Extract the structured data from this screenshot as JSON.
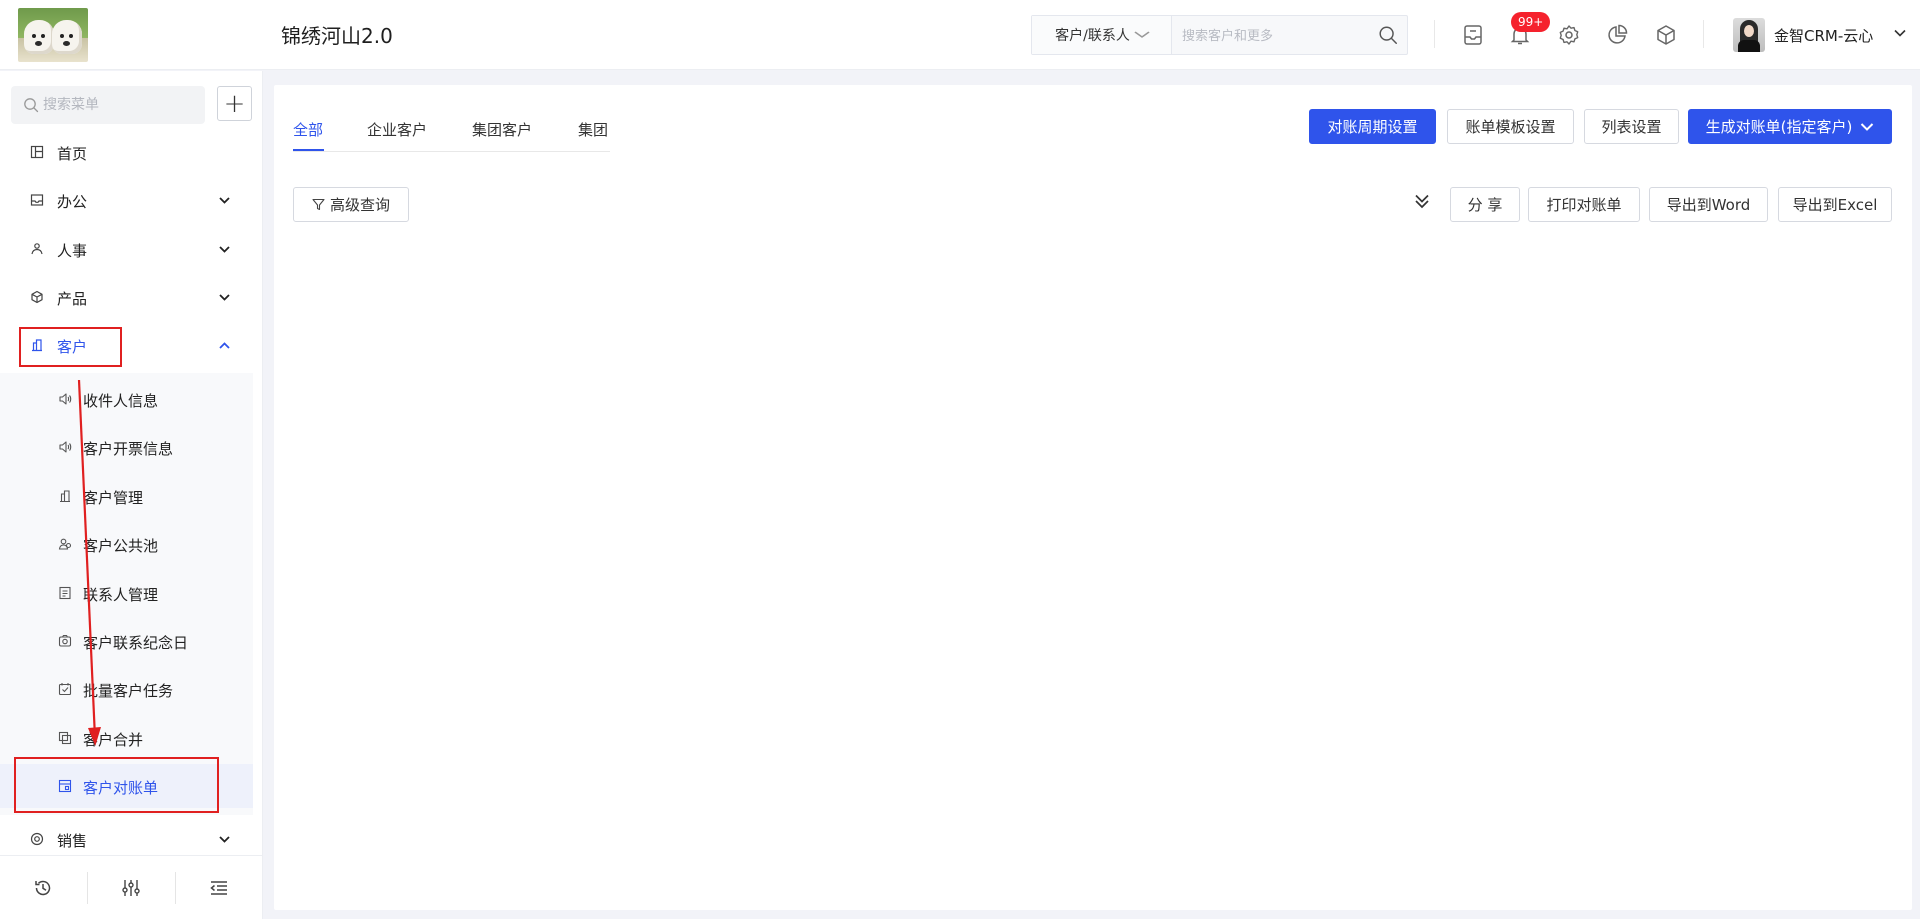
{
  "header": {
    "app_title": "锦绣河山2.0",
    "search_type": "客户/联系人",
    "search_placeholder": "搜索客户和更多",
    "notification_badge": "99+",
    "user_name": "金智CRM-云心"
  },
  "sidebar": {
    "search_placeholder": "搜索菜单",
    "items": [
      {
        "label": "首页"
      },
      {
        "label": "办公"
      },
      {
        "label": "人事"
      },
      {
        "label": "产品"
      },
      {
        "label": "客户"
      },
      {
        "label": "销售"
      }
    ],
    "customer_sub_items": [
      {
        "label": "收件人信息"
      },
      {
        "label": "客户开票信息"
      },
      {
        "label": "客户管理"
      },
      {
        "label": "客户公共池"
      },
      {
        "label": "联系人管理"
      },
      {
        "label": "客户联系纪念日"
      },
      {
        "label": "批量客户任务"
      },
      {
        "label": "客户合并"
      },
      {
        "label": "客户对账单"
      }
    ]
  },
  "main": {
    "tabs": [
      {
        "label": "全部"
      },
      {
        "label": "企业客户"
      },
      {
        "label": "集团客户"
      },
      {
        "label": "集团"
      }
    ],
    "toolbar_top": {
      "period_settings": "对账周期设置",
      "template_settings": "账单模板设置",
      "list_settings": "列表设置",
      "generate_statement": "生成对账单(指定客户)"
    },
    "toolbar_second": {
      "advanced_query": "高级查询",
      "share": "分 享",
      "print_statement": "打印对账单",
      "export_word": "导出到Word",
      "export_excel": "导出到Excel"
    }
  },
  "colors": {
    "accent": "#2f54eb",
    "annotation": "#e02020",
    "badge": "#f5222d"
  }
}
